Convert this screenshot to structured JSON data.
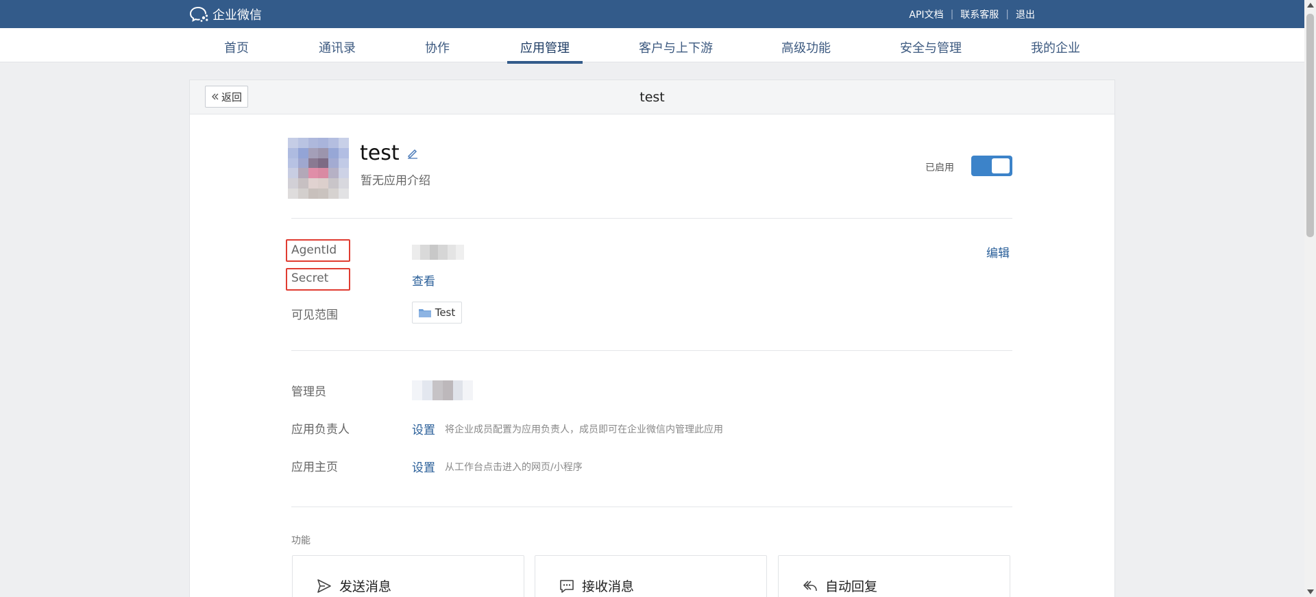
{
  "brand": {
    "name": "企业微信"
  },
  "top_links": [
    {
      "label": "API文档"
    },
    {
      "label": "联系客服"
    },
    {
      "label": "退出"
    }
  ],
  "nav": [
    {
      "label": "首页"
    },
    {
      "label": "通讯录"
    },
    {
      "label": "协作"
    },
    {
      "label": "应用管理",
      "active": true
    },
    {
      "label": "客户与上下游"
    },
    {
      "label": "高级功能"
    },
    {
      "label": "安全与管理"
    },
    {
      "label": "我的企业"
    }
  ],
  "card": {
    "back_label": "返回",
    "title": "test"
  },
  "app": {
    "name": "test",
    "description": "暂无应用介绍",
    "status_label": "已启用",
    "enabled": true
  },
  "details": {
    "agentid_label": "AgentId",
    "edit_label": "编辑",
    "secret_label": "Secret",
    "secret_view": "查看",
    "visibility_label": "可见范围",
    "visibility_dept": "Test",
    "admin_label": "管理员",
    "owner_label": "应用负责人",
    "owner_action": "设置",
    "owner_hint": "将企业成员配置为应用负责人，成员即可在企业微信内管理此应用",
    "homepage_label": "应用主页",
    "homepage_action": "设置",
    "homepage_hint": "从工作台点击进入的网页/小程序"
  },
  "features": {
    "section_label": "功能",
    "items": [
      {
        "label": "发送消息",
        "icon": "send-icon"
      },
      {
        "label": "接收消息",
        "icon": "chat-bubble-icon"
      },
      {
        "label": "自动回复",
        "icon": "reply-icon"
      }
    ]
  },
  "colors": {
    "topbar": "#335b8a",
    "link": "#2a5f99",
    "toggle_on": "#3c83c9",
    "highlight_box": "#e03c31"
  }
}
